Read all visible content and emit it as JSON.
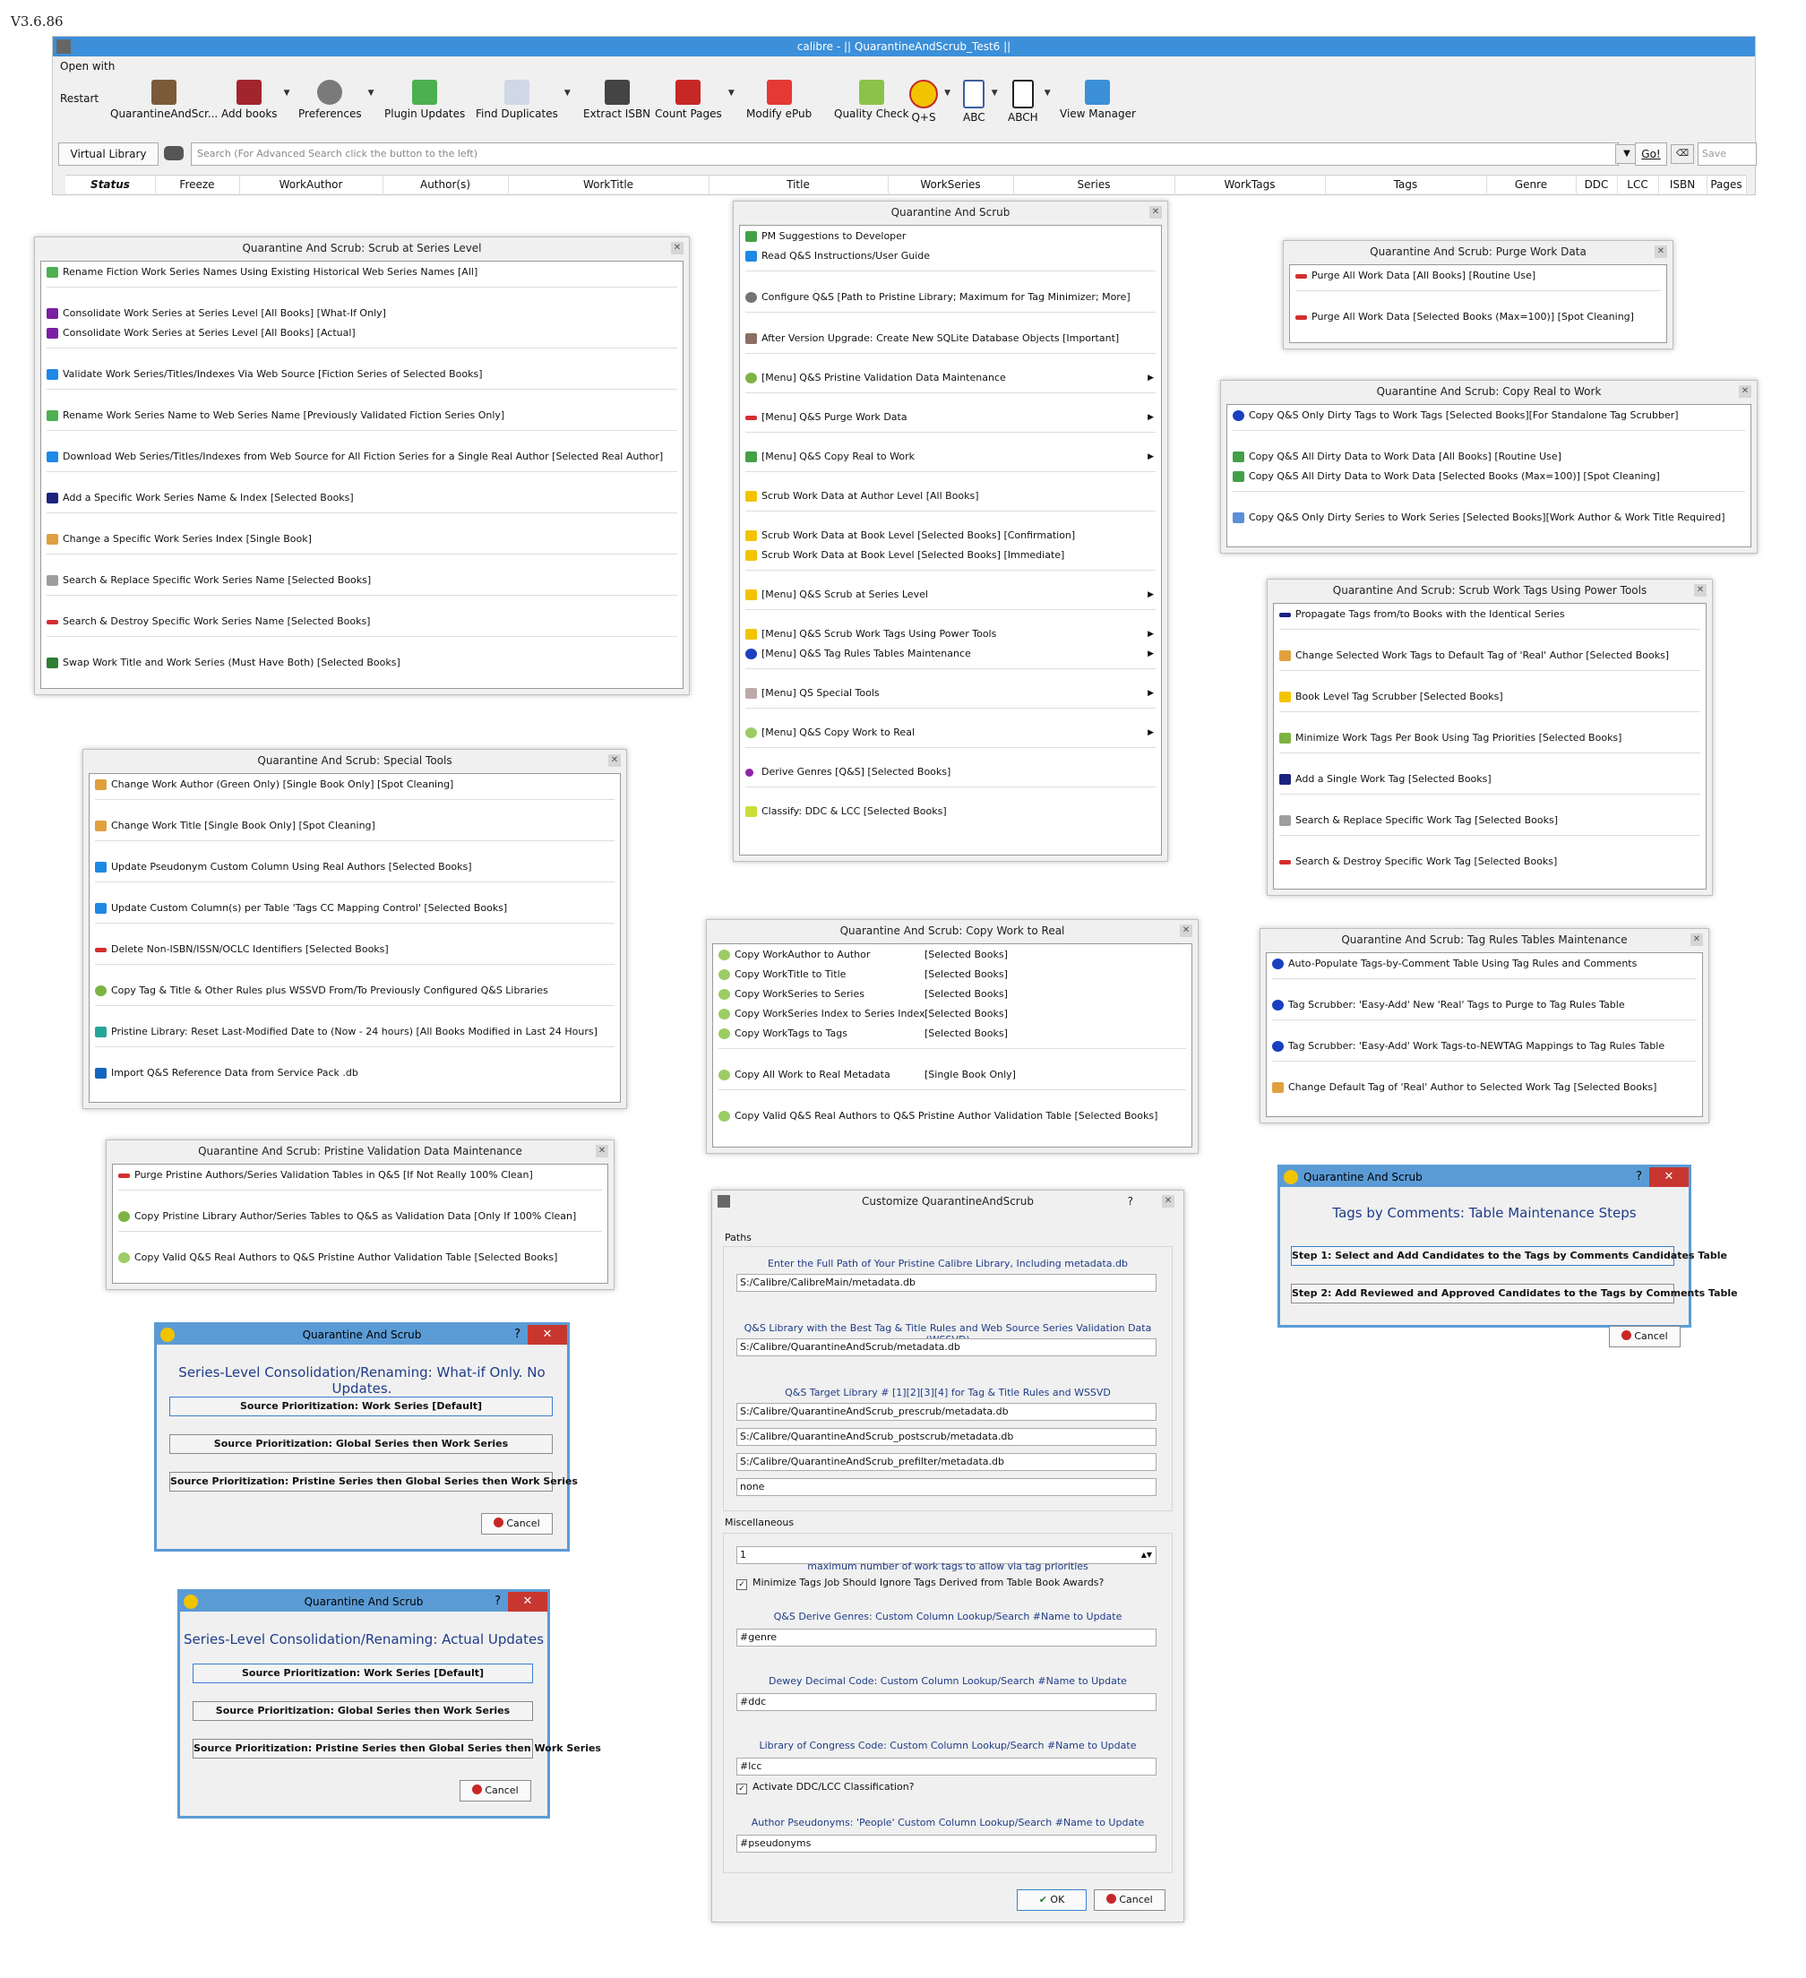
{
  "version": "V3.6.86",
  "main_window": {
    "title": "calibre - || QuarantineAndScrub_Test6 ||",
    "open_with": "Open with",
    "restart": "Restart",
    "toolbar": [
      {
        "label": "QuarantineAndScr...",
        "icon": "books-icon"
      },
      {
        "label": "Add books",
        "icon": "add-books-icon"
      },
      {
        "label": "Preferences",
        "icon": "preferences-icon"
      },
      {
        "label": "Plugin Updates",
        "icon": "plugin-updates-icon"
      },
      {
        "label": "Find Duplicates",
        "icon": "find-duplicates-icon"
      },
      {
        "label": "Extract ISBN",
        "icon": "barcode-icon"
      },
      {
        "label": "Count Pages",
        "icon": "count-pages-icon"
      },
      {
        "label": "Modify ePub",
        "icon": "modify-epub-icon"
      },
      {
        "label": "Quality Check",
        "icon": "quality-check-icon"
      },
      {
        "label": "Q+S",
        "icon": "biohazard-icon"
      },
      {
        "label": "ABC",
        "icon": "abc-icon"
      },
      {
        "label": "ABCH",
        "icon": "abch-icon"
      },
      {
        "label": "View Manager",
        "icon": "view-manager-icon"
      }
    ],
    "virtual_library": "Virtual Library",
    "search_placeholder": "Search (For Advanced Search click the button to the left)",
    "go": "Go!",
    "saved": "Save",
    "columns": [
      "Status",
      "Freeze",
      "WorkAuthor",
      "Author(s)",
      "WorkTitle",
      "Title",
      "WorkSeries",
      "Series",
      "WorkTags",
      "Tags",
      "Genre",
      "DDC",
      "LCC",
      "ISBN",
      "Pages"
    ]
  },
  "dialogs": {
    "series_level": {
      "title": "Quarantine And Scrub: Scrub at Series Level",
      "items": [
        "Rename Fiction Work Series Names Using Existing Historical Web Series Names [All]",
        "Consolidate Work Series at Series Level [All Books]  [What-If Only]",
        "Consolidate Work Series at Series Level [All Books]  [Actual]",
        "Validate Work Series/Titles/Indexes Via Web Source [Fiction Series of Selected Books]",
        "Rename Work Series Name to Web Series Name [Previously Validated Fiction Series Only]",
        "Download Web Series/Titles/Indexes from Web Source for All Fiction Series for a Single Real Author [Selected Real Author]",
        "Add a Specific Work Series Name & Index [Selected Books]",
        "Change a Specific Work Series Index [Single Book]",
        "Search & Replace Specific Work Series Name [Selected Books]",
        "Search & Destroy Specific Work Series Name [Selected Books]",
        "Swap Work Title and Work Series  (Must Have Both)  [Selected Books]"
      ]
    },
    "main_menu": {
      "title": "Quarantine And Scrub",
      "items": [
        "PM Suggestions to Developer",
        "Read Q&S Instructions/User Guide",
        "Configure Q&S [Path to Pristine Library; Maximum for Tag Minimizer; More]",
        "After Version Upgrade: Create New SQLite Database Objects [Important]",
        "[Menu] Q&S Pristine Validation Data Maintenance",
        "[Menu] Q&S Purge Work Data",
        "[Menu] Q&S Copy Real to Work",
        "Scrub Work Data at Author Level [All Books]",
        "Scrub Work Data at Book Level [Selected Books]  [Confirmation]",
        "Scrub Work Data at Book Level [Selected Books]  [Immediate]",
        "[Menu] Q&S Scrub at Series Level",
        "[Menu] Q&S Scrub Work Tags Using Power Tools",
        "[Menu] Q&S Tag Rules Tables Maintenance",
        "[Menu] QS Special Tools",
        "[Menu] Q&S Copy Work to Real",
        "Derive Genres [Q&S] [Selected Books]",
        "Classify: DDC & LCC  [Selected Books]"
      ]
    },
    "purge": {
      "title": "Quarantine And Scrub: Purge Work Data",
      "items": [
        "Purge All Work Data [All Books] [Routine Use]",
        "Purge All Work Data [Selected Books (Max=100)] [Spot Cleaning]"
      ]
    },
    "copy_real_to_work": {
      "title": "Quarantine And Scrub: Copy Real to Work",
      "items": [
        "Copy Q&S Only Dirty Tags to Work Tags [Selected Books][For Standalone Tag Scrubber]",
        "Copy Q&S All Dirty Data to Work Data [All Books] [Routine Use]",
        "Copy Q&S All Dirty Data to Work Data [Selected Books (Max=100)] [Spot Cleaning]",
        "Copy Q&S Only Dirty Series to Work Series [Selected Books][Work Author & Work Title Required]"
      ]
    },
    "power_tools": {
      "title": "Quarantine And Scrub: Scrub Work Tags Using Power Tools",
      "items": [
        "Propagate Tags from/to Books with the Identical Series",
        "Change Selected Work Tags to Default Tag of 'Real' Author [Selected Books]",
        "Book Level Tag Scrubber [Selected Books]",
        "Minimize Work Tags Per Book Using Tag Priorities [Selected Books]",
        "Add a Single Work Tag [Selected Books]",
        "Search & Replace Specific Work Tag [Selected Books]",
        "Search & Destroy Specific Work Tag [Selected Books]"
      ]
    },
    "special_tools": {
      "title": "Quarantine And Scrub: Special Tools",
      "items": [
        "Change Work Author (Green Only) [Single Book Only] [Spot Cleaning]",
        "Change Work Title [Single Book Only] [Spot Cleaning]",
        "Update Pseudonym Custom Column Using Real Authors [Selected Books]",
        "Update Custom Column(s) per Table 'Tags CC Mapping Control' [Selected Books]",
        "Delete Non-ISBN/ISSN/OCLC Identifiers [Selected Books]",
        "Copy Tag & Title & Other Rules plus WSSVD From/To Previously Configured Q&S Libraries",
        "Pristine Library: Reset Last-Modified Date to (Now - 24 hours) [All Books Modified in Last 24 Hours]",
        "Import Q&S Reference Data from Service Pack .db"
      ]
    },
    "copy_work_to_real": {
      "title": "Quarantine And Scrub: Copy Work to Real",
      "items": [
        [
          "Copy WorkAuthor to Author",
          "[Selected Books]"
        ],
        [
          "Copy WorkTitle to Title",
          "[Selected Books]"
        ],
        [
          "Copy WorkSeries to Series",
          "[Selected Books]"
        ],
        [
          "Copy WorkSeries Index to Series Index",
          "[Selected Books]"
        ],
        [
          "Copy WorkTags to Tags",
          "[Selected Books]"
        ],
        [
          "Copy All Work to Real Metadata",
          "[Single Book Only]"
        ],
        [
          "Copy Valid Q&S Real Authors to Q&S Pristine Author Validation Table [Selected Books]",
          ""
        ]
      ]
    },
    "tag_rules": {
      "title": "Quarantine And Scrub: Tag Rules Tables Maintenance",
      "items": [
        "Auto-Populate Tags-by-Comment Table Using Tag Rules and Comments",
        "Tag Scrubber: 'Easy-Add' New 'Real' Tags to Purge to Tag Rules Table",
        "Tag Scrubber: 'Easy-Add' Work Tags-to-NEWTAG Mappings to Tag Rules Table",
        "Change Default Tag of 'Real' Author to Selected Work Tag [Selected Books]"
      ]
    },
    "pristine": {
      "title": "Quarantine And Scrub: Pristine Validation Data Maintenance",
      "items": [
        "Purge Pristine Authors/Series Validation Tables in Q&S [If Not Really 100% Clean]",
        "Copy Pristine Library Author/Series Tables to Q&S as Validation Data [Only If 100% Clean]",
        "Copy Valid Q&S Real Authors to Q&S Pristine Author Validation Table [Selected Books]"
      ]
    },
    "whatif": {
      "title": "Quarantine And Scrub",
      "help": "?",
      "close": "✕",
      "heading": "Series-Level Consolidation/Renaming: What-if Only. No Updates.",
      "buttons": [
        "Source Prioritization:  Work Series [Default]",
        "Source Prioritization: Global Series then Work Series",
        "Source Prioritization: Pristine Series then Global Series then Work Series"
      ],
      "cancel": "Cancel"
    },
    "actual": {
      "title": "Quarantine And Scrub",
      "help": "?",
      "close": "✕",
      "heading": "Series-Level Consolidation/Renaming: Actual Updates",
      "buttons": [
        "Source Prioritization:  Work Series [Default]",
        "Source Prioritization: Global Series then Work Series",
        "Source Prioritization: Pristine Series then Global Series then Work Series"
      ],
      "cancel": "Cancel"
    },
    "tags_by_comments": {
      "title": "Quarantine And Scrub",
      "help": "?",
      "close": "✕",
      "heading": "Tags by Comments: Table Maintenance Steps",
      "buttons": [
        "Step 1: Select and Add Candidates to the Tags by Comments Candidates Table",
        "Step 2: Add Reviewed and Approved Candidates to the Tags by Comments Table"
      ],
      "cancel": "Cancel"
    },
    "customize": {
      "title": "Customize QuarantineAndScrub",
      "help": "?",
      "paths_label": "Paths",
      "pristine_label": "Enter the Full Path of Your Pristine Calibre Library, Including metadata.db",
      "pristine_value": "S:/Calibre/CalibreMain/metadata.db",
      "wssvd_label": "Q&S Library with the Best Tag & Title Rules and Web Source Series Validation Data (WSSVD)",
      "wssvd_value": "S:/Calibre/QuarantineAndScrub/metadata.db",
      "target_label": "Q&S Target Library # [1][2][3][4] for Tag & Title Rules and WSSVD",
      "target_values": [
        "S:/Calibre/QuarantineAndScrub_prescrub/metadata.db",
        "S:/Calibre/QuarantineAndScrub_postscrub/metadata.db",
        "S:/Calibre/QuarantineAndScrub_prefilter/metadata.db",
        "none"
      ],
      "misc_label": "Miscellaneous",
      "max_tags_value": "1",
      "max_tags_label": "maximum number of work tags to allow via tag priorities",
      "minimize_check": "Minimize Tags Job Should Ignore Tags Derived from Table Book Awards?",
      "genres_label": "Q&S Derive Genres: Custom Column Lookup/Search #Name to Update",
      "genres_value": "#genre",
      "ddc_label": "Dewey Decimal Code: Custom Column Lookup/Search #Name to Update",
      "ddc_value": "#ddc",
      "lcc_label": "Library of Congress Code: Custom Column Lookup/Search #Name to Update",
      "lcc_value": "#lcc",
      "activate_check": "Activate DDC/LCC Classification?",
      "pseudonym_label": "Author Pseudonyms: 'People' Custom Column Lookup/Search #Name to Update",
      "pseudonym_value": "#pseudonyms",
      "ok": "OK",
      "cancel": "Cancel"
    }
  },
  "colors": {
    "title_blue": "#3c8fd9",
    "dialog_blue": "#5b9bd5",
    "heading_blue": "#1f3c88",
    "close_red": "#c7372f"
  }
}
